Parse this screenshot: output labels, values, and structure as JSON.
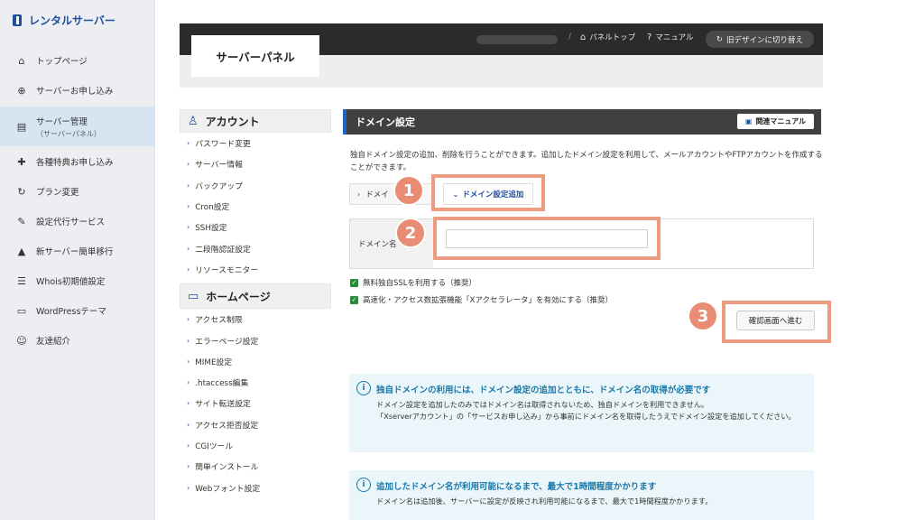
{
  "sidebar": {
    "brand": "レンタルサーバー",
    "items": [
      {
        "icon": "house",
        "label": "トップページ"
      },
      {
        "icon": "plus-circle",
        "label": "サーバーお申し込み"
      },
      {
        "icon": "server",
        "label": "サーバー管理",
        "sub": "（サーバーパネル）"
      },
      {
        "icon": "gift",
        "label": "各種特典お申し込み"
      },
      {
        "icon": "refresh",
        "label": "プラン変更"
      },
      {
        "icon": "wrench",
        "label": "設定代行サービス"
      },
      {
        "icon": "upload",
        "label": "新サーバー簡単移行"
      },
      {
        "icon": "document",
        "label": "Whois初期値設定"
      },
      {
        "icon": "window",
        "label": "WordPressテーマ"
      },
      {
        "icon": "user",
        "label": "友達紹介"
      }
    ]
  },
  "header": {
    "panel_title": "サーバーパネル",
    "panel_top": "パネルトップ",
    "manual": "マニュアル",
    "old_design": "旧デザインに切り替え"
  },
  "menu": {
    "account_title": "アカウント",
    "account_items": [
      "パスワード変更",
      "サーバー情報",
      "バックアップ",
      "Cron設定",
      "SSH設定",
      "二段階認証設定",
      "リソースモニター"
    ],
    "homepage_title": "ホームページ",
    "homepage_items": [
      "アクセス制限",
      "エラーページ設定",
      "MIME設定",
      ".htaccess編集",
      "サイト転送設定",
      "アクセス拒否設定",
      "CGIツール",
      "簡単インストール",
      "Webフォント設定"
    ]
  },
  "main": {
    "title": "ドメイン設定",
    "manual_button": "関連マニュアル",
    "description": "独自ドメイン設定の追加、削除を行うことができます。追加したドメイン設定を利用して、メールアカウントやFTPアカウントを作成することができます。",
    "tab_list": "ドメイ",
    "tab_add": "ドメイン設定追加",
    "domain_label": "ドメイン名",
    "domain_value": "",
    "ssl_check": "無料独自SSLを利用する（推奨）",
    "xaccel_check": "高速化・アクセス数拡張機能「Xアクセラレータ」を有効にする（推奨）",
    "confirm_button": "確認画面へ進む"
  },
  "steps": [
    "1",
    "2",
    "3"
  ],
  "info1": {
    "title": "独自ドメインの利用には、ドメイン設定の追加とともに、ドメイン名の取得が必要です",
    "line1": "ドメイン設定を追加したのみではドメイン名は取得されないため、独自ドメインを利用できません。",
    "line2": "「Xserverアカウント」の「サービスお申し込み」から事前にドメイン名を取得したうえでドメイン設定を追加してください。"
  },
  "info2": {
    "title": "追加したドメイン名が利用可能になるまで、最大で1時間程度かかります",
    "line1": "ドメイン名は追加後、サーバーに設定が反映され利用可能になるまで、最大で1時間程度かかります。"
  },
  "colors": {
    "accent": "#1f4fa0",
    "highlight": "#ec9c80",
    "header_dark": "#2b2b2b"
  }
}
